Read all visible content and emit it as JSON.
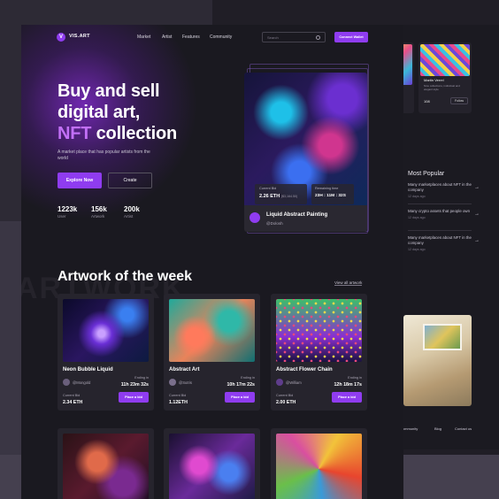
{
  "nav": {
    "logo_mark": "V",
    "logo": "VIS.ART",
    "links": [
      "Market",
      "Artist",
      "Features",
      "Community"
    ],
    "search_placeholder": "Search",
    "connect": "Connect Wallet"
  },
  "hero": {
    "line1": "Buy and sell",
    "line2": "digital art,",
    "line3_accent": "NFT",
    "line3_rest": " collection",
    "subtitle": "A market place that has popular artists from the world",
    "explore": "Explore Now",
    "create": "Create",
    "stats": [
      {
        "value": "1223k",
        "label": "User"
      },
      {
        "value": "156k",
        "label": "Artwork"
      },
      {
        "value": "200k",
        "label": "Artist"
      }
    ]
  },
  "featured": {
    "current_bid_label": "Current Bid",
    "current_bid": "2.26 ETH",
    "current_bid_usd": "($3,164.50)",
    "remaining_label": "Remaining time",
    "remaining": "23H : 11M : 32S",
    "title": "Liquid Abstract Painting",
    "user": "@Dolosh"
  },
  "artwork": {
    "watermark": "ARTWORK",
    "title": "Artwork of the week",
    "view_all": "View all artwork",
    "ending_label": "Ending in",
    "bid_label": "Current Bid",
    "bid_button": "Place a bid",
    "cards": [
      {
        "name": "Neon Bubble Liquid",
        "user": "@Mongold",
        "ending": "11h 23m 32s",
        "bid": "2.34 ETH"
      },
      {
        "name": "Abstract Art",
        "user": "@Sutris",
        "ending": "10h 17m 22s",
        "bid": "1.12ETH"
      },
      {
        "name": "Abstract Flower Chain",
        "user": "@William",
        "ending": "12h 18m 17s",
        "bid": "2.00 ETH"
      }
    ]
  },
  "side": {
    "artist": "Martin Verrel",
    "artist_sub": "Nice collections, individual and elegant style",
    "stat": "108",
    "follow": "Follow",
    "most_popular": "Most Popular",
    "items": [
      {
        "text": "Many marketplaces about NFT in the company",
        "date": "12 days ago"
      },
      {
        "text": "Many crypto assets that people own",
        "date": "12 days ago"
      },
      {
        "text": "Many marketplaces about NFT in the company",
        "date": "12 days ago"
      }
    ],
    "footer_links": [
      "Community",
      "Blog",
      "Contact us"
    ]
  },
  "colors": {
    "accent": "#8f3cf0",
    "accent_text": "#c270f7",
    "page_bg": "#1a1920"
  }
}
